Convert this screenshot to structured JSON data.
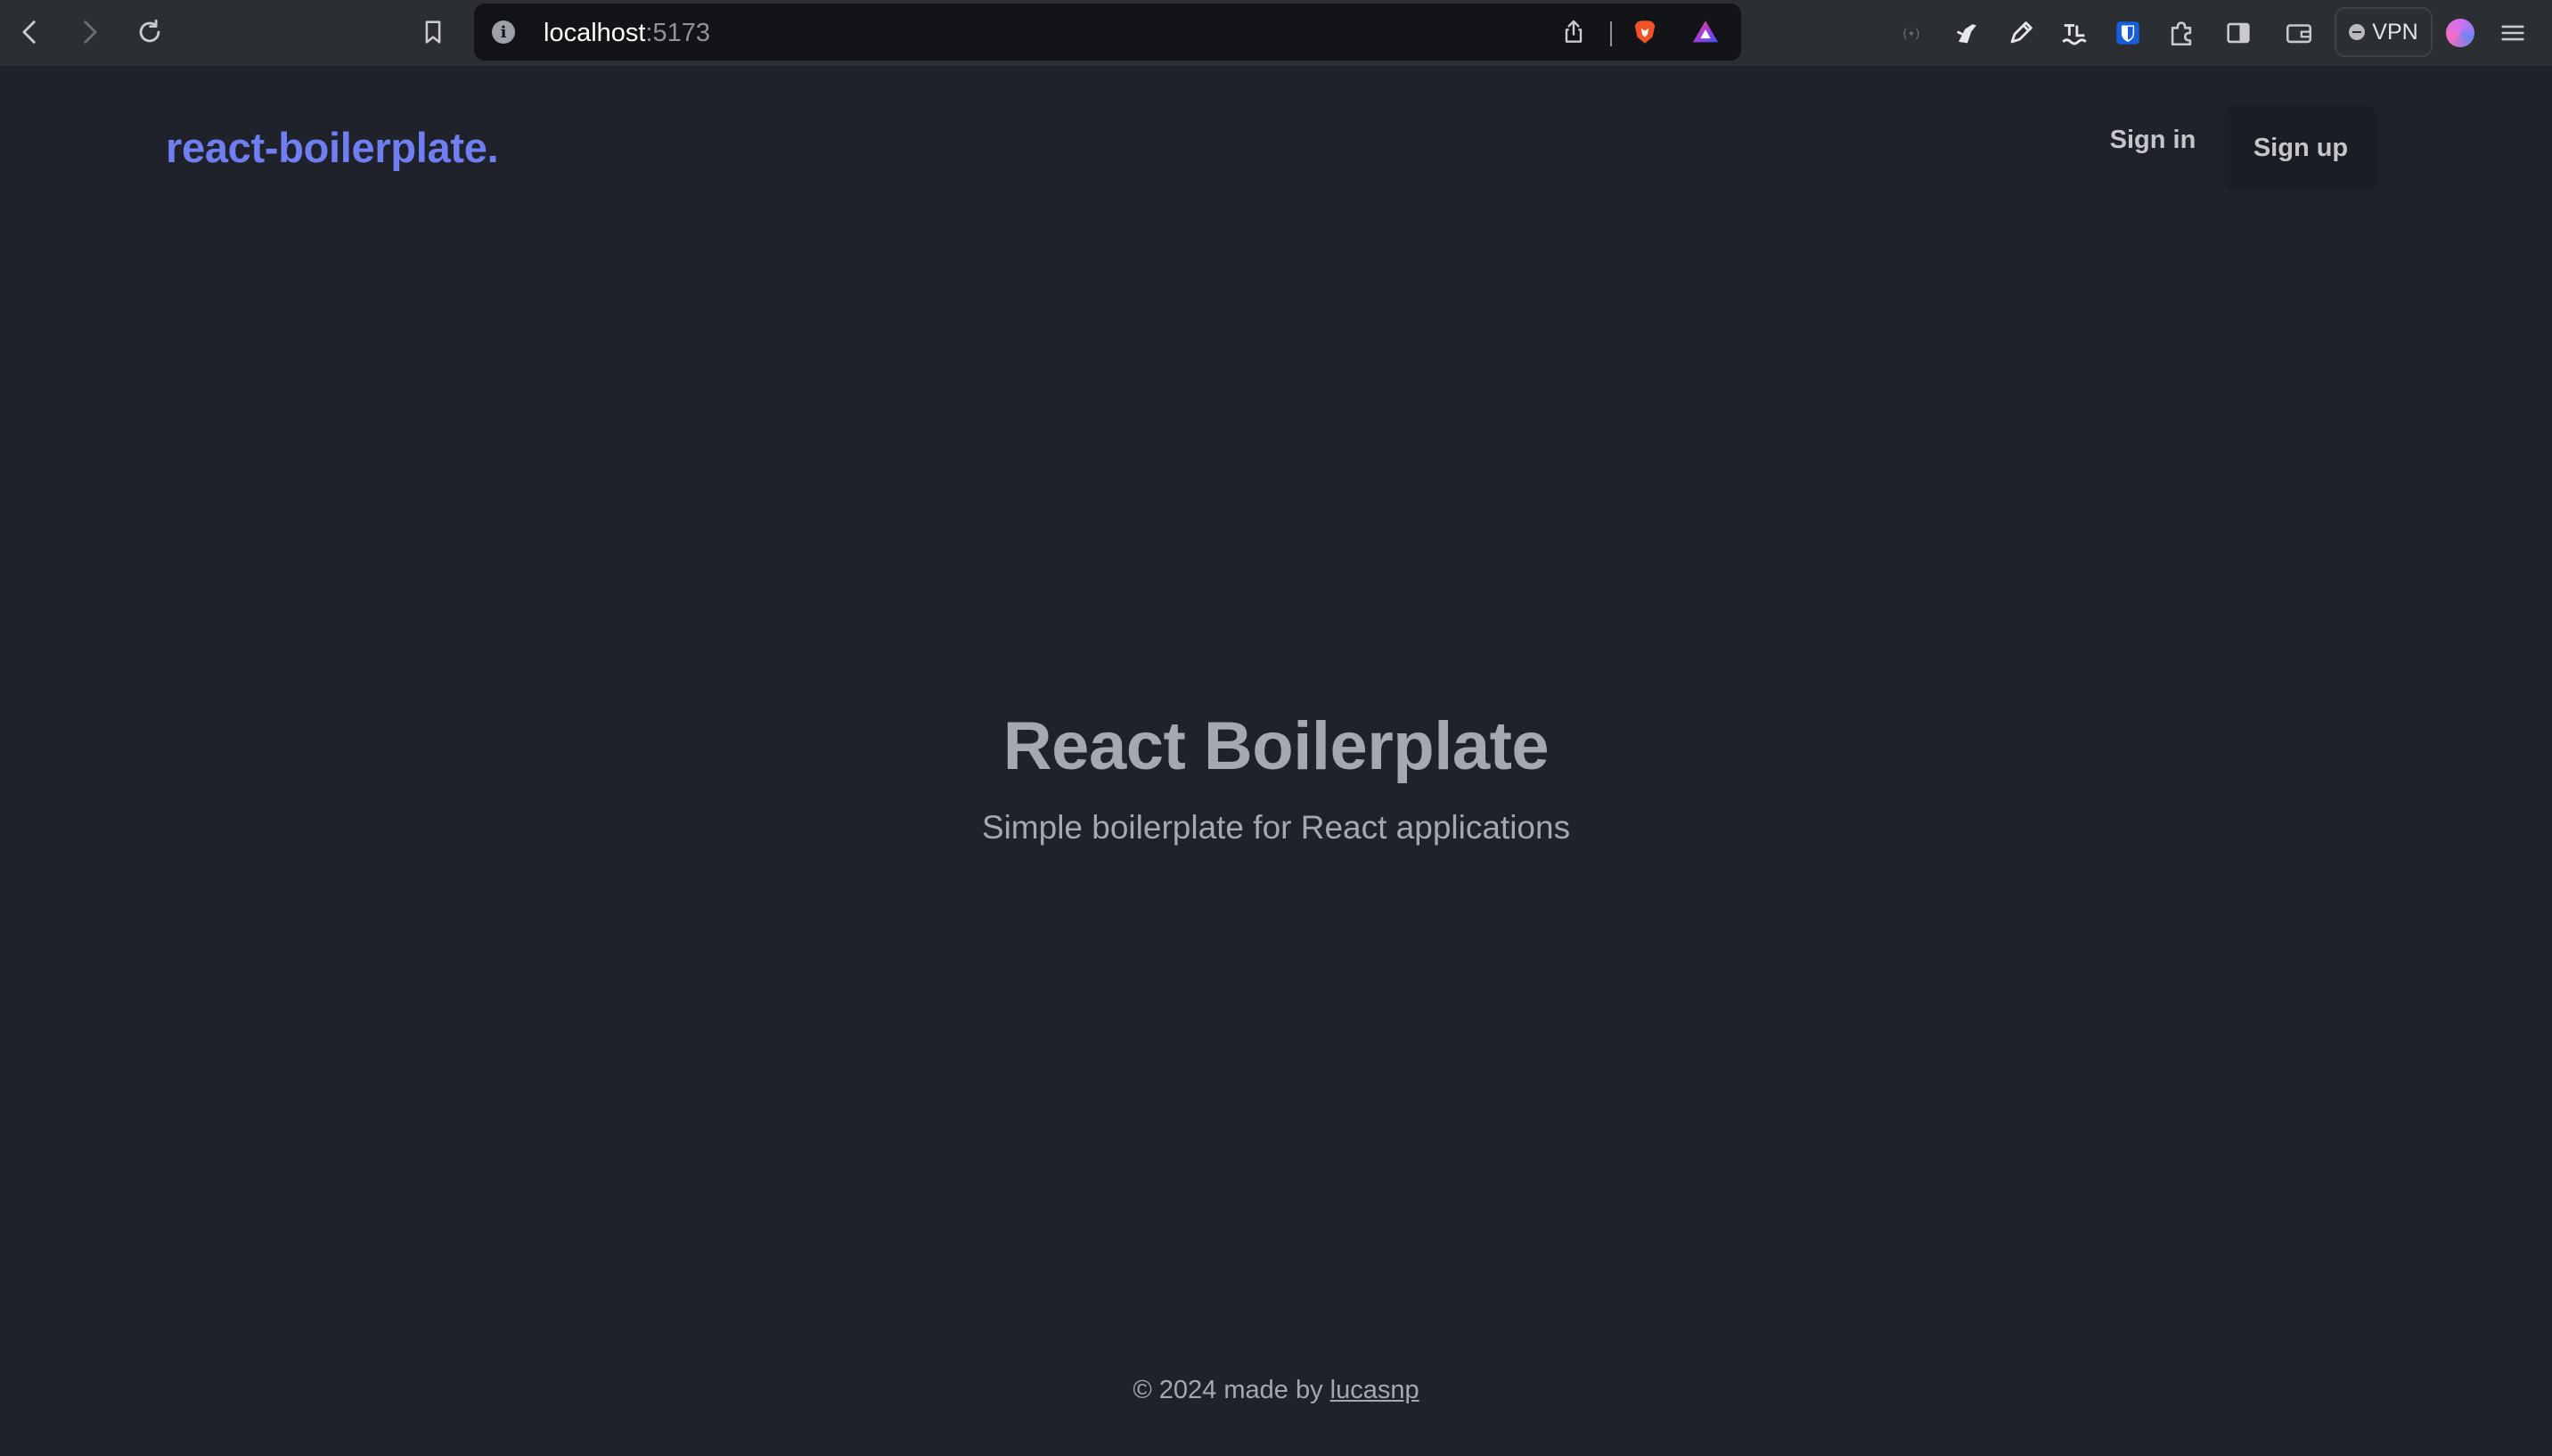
{
  "browser": {
    "url_host": "localhost",
    "url_port": ":5173",
    "vpn_label": "VPN",
    "icons": {
      "back": "chevron-left-icon",
      "forward": "chevron-right-icon",
      "reload": "reload-icon",
      "bookmark": "bookmark-icon",
      "site_info": "info-icon",
      "share": "share-icon",
      "brave_shields": "brave-lion-icon",
      "brave_rewards": "triangle-icon",
      "extensions": [
        "wifi-icon",
        "rocket-icon",
        "pen-icon",
        "wave-icon",
        "bitwarden-shield-icon",
        "puzzle-icon",
        "sidebar-icon",
        "wallet-icon"
      ],
      "menu": "hamburger-icon"
    }
  },
  "header": {
    "logo": "react-boilerplate.",
    "signin_label": "Sign in",
    "signup_label": "Sign up"
  },
  "hero": {
    "title": "React Boilerplate",
    "subtitle": "Simple boilerplate for React applications"
  },
  "footer": {
    "prefix": "© 2024 made by ",
    "author_link": "lucasnp"
  },
  "colors": {
    "background": "#1f222a",
    "browser_bar": "#2b2e33",
    "logo_accent": "#6f7ef0",
    "text_muted": "#a5a8b0"
  }
}
